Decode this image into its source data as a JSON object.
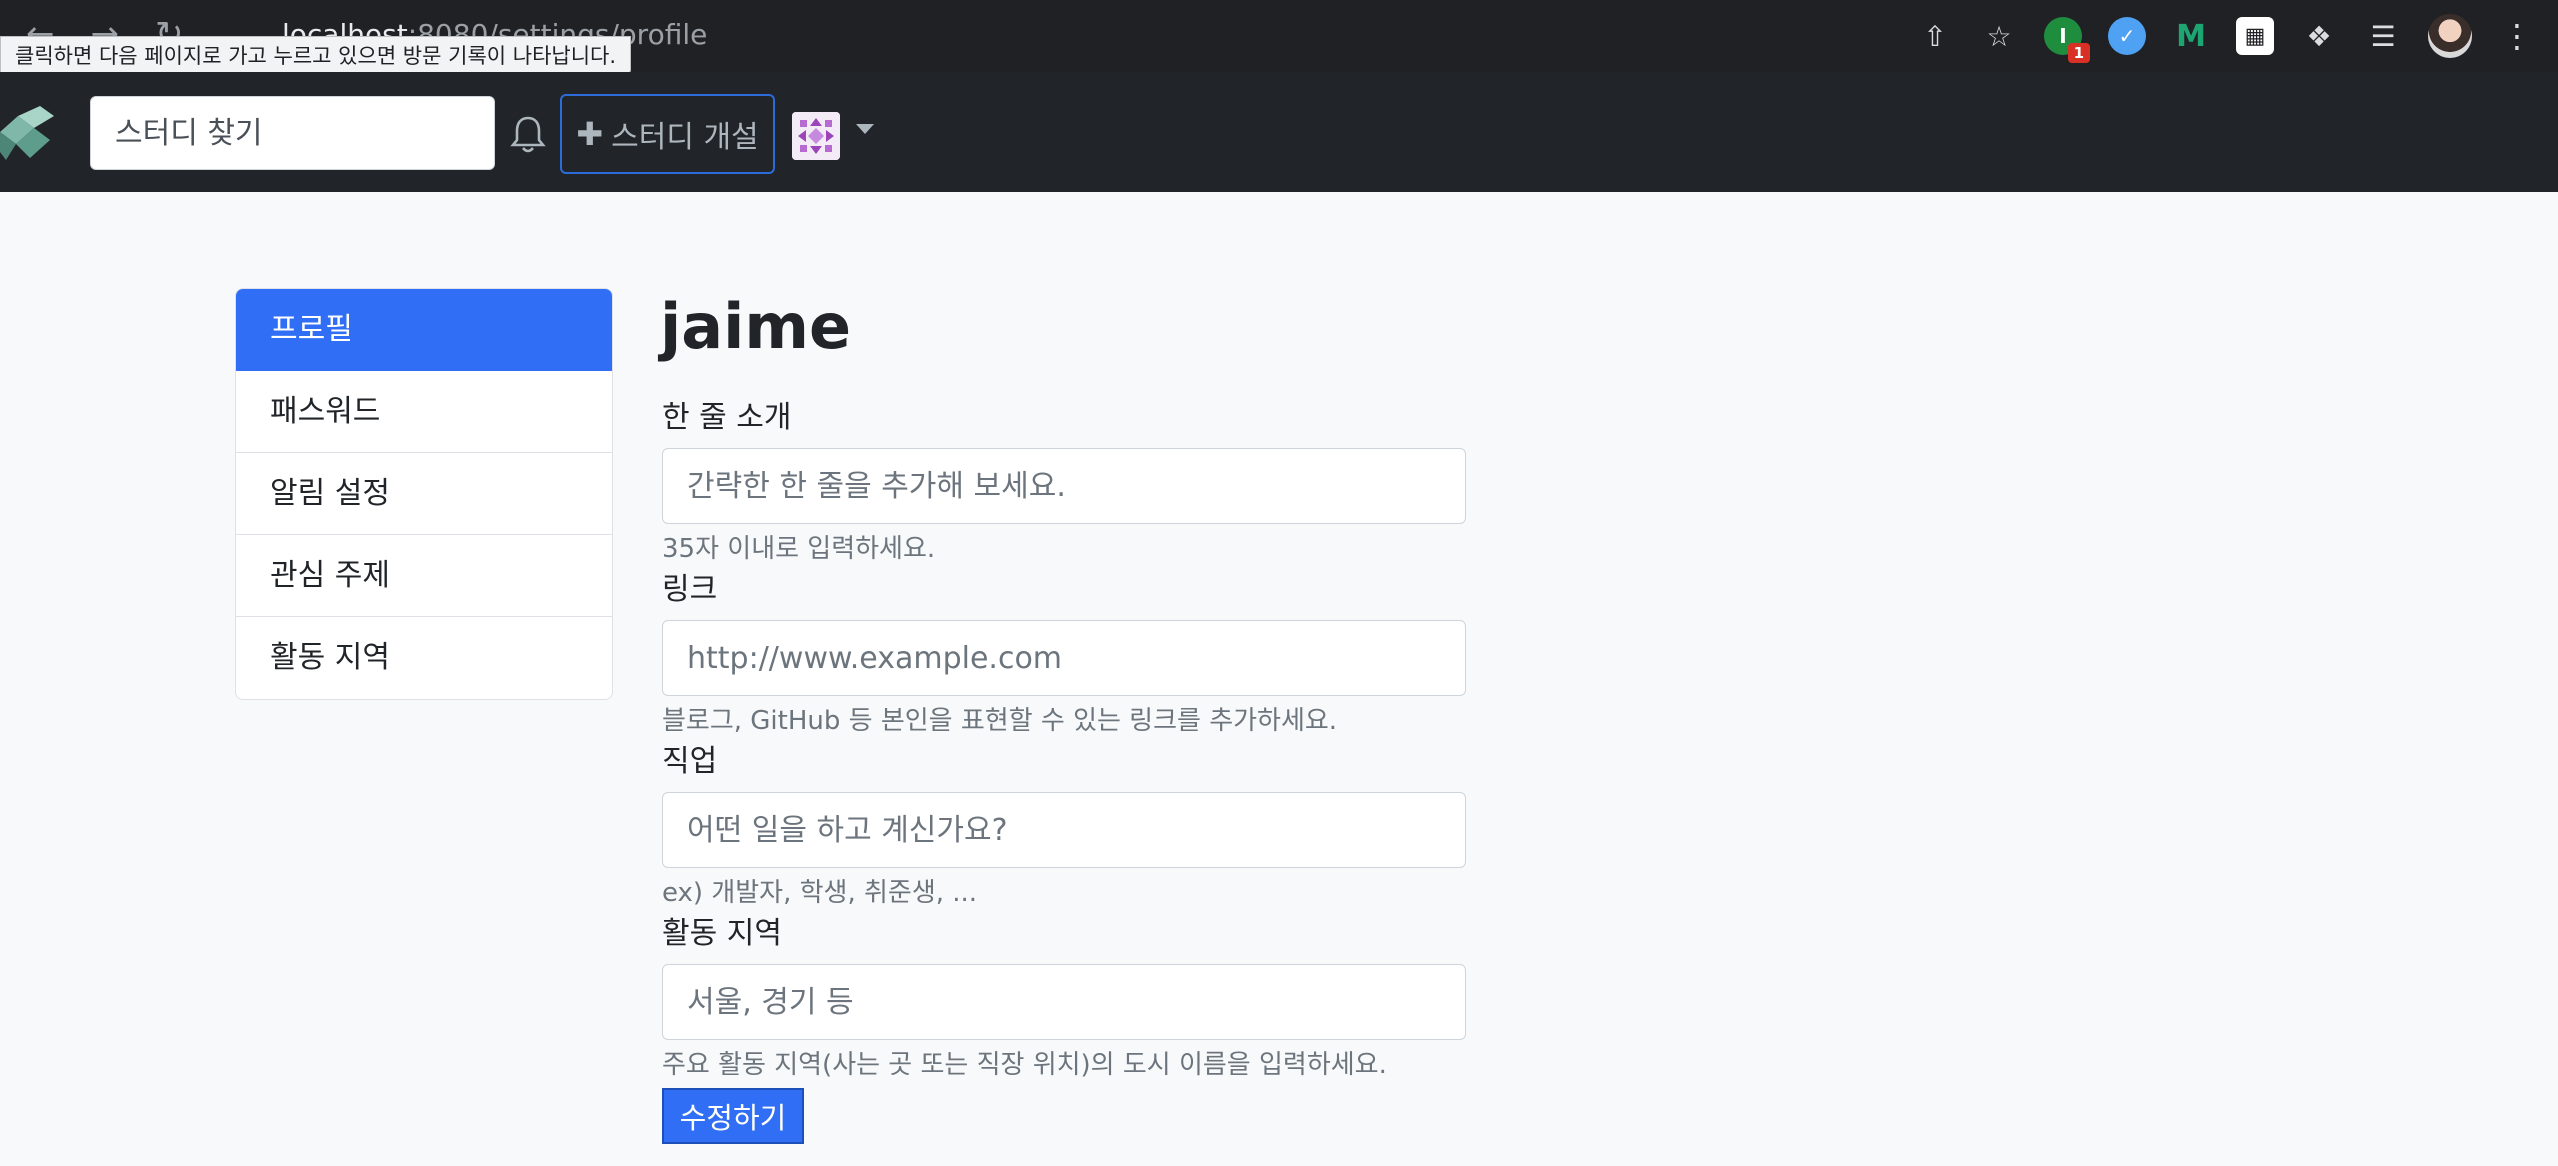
{
  "browser": {
    "url_host": "localhost",
    "url_rest": ":8080/settings/profile",
    "tooltip": "클릭하면 다음 페이지로 가고 누르고 있으면 방문 기록이 나타납니다.",
    "extension_badge": "1",
    "ext_m_label": "M"
  },
  "navbar": {
    "search_placeholder": "스터디 찾기",
    "create_study_label": "스터디 개설"
  },
  "sidebar": {
    "items": [
      {
        "label": "프로필",
        "active": true
      },
      {
        "label": "패스워드",
        "active": false
      },
      {
        "label": "알림 설정",
        "active": false
      },
      {
        "label": "관심 주제",
        "active": false
      },
      {
        "label": "활동 지역",
        "active": false
      }
    ]
  },
  "profile": {
    "username": "jaime",
    "bio": {
      "label": "한 줄 소개",
      "placeholder": "간략한 한 줄을 추가해 보세요.",
      "help": "35자 이내로 입력하세요."
    },
    "url": {
      "label": "링크",
      "placeholder": "http://www.example.com",
      "help": "블로그, GitHub 등 본인을 표현할 수 있는 링크를 추가하세요."
    },
    "occupation": {
      "label": "직업",
      "placeholder": "어떤 일을 하고 계신가요?",
      "help": "ex) 개발자, 학생, 취준생, ..."
    },
    "location": {
      "label": "활동 지역",
      "placeholder": "서울, 경기 등",
      "help": "주요 활동 지역(사는 곳 또는 직장 위치)의 도시 이름을 입력하세요."
    },
    "submit_label": "수정하기"
  },
  "colors": {
    "primary": "#2f6ef5",
    "navbar_bg": "#212529",
    "page_bg": "#f8f9fa"
  }
}
